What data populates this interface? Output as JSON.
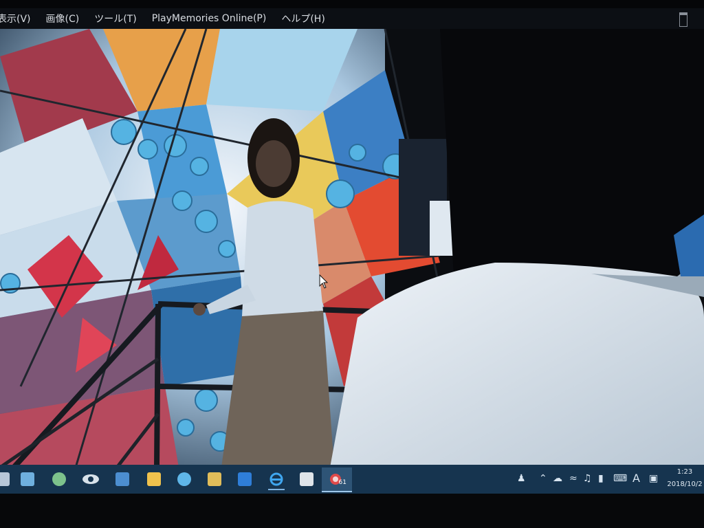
{
  "menubar": {
    "items": [
      "表示(V)",
      "画像(C)",
      "ツール(T)",
      "PlayMemories Online(P)",
      "ヘルプ(H)"
    ]
  },
  "taskbar": {
    "apps": [
      {
        "icon": "file-app-icon",
        "color": "#b8c7d8"
      },
      {
        "icon": "photo-editor-icon",
        "color": "#6fb0de"
      },
      {
        "icon": "green-app-icon",
        "color": "#7dc28c"
      },
      {
        "icon": "eye-icon",
        "color": "#d8e2ea"
      },
      {
        "icon": "blue-app-icon",
        "color": "#4c8ed0"
      },
      {
        "icon": "file-explorer-icon",
        "color": "#f0c24d"
      },
      {
        "icon": "globe-icon",
        "color": "#5fb6e8"
      },
      {
        "icon": "photos-folder-icon",
        "color": "#e1bd5a"
      },
      {
        "icon": "outlook-icon",
        "color": "#2f7ed8"
      },
      {
        "icon": "internet-explorer-icon",
        "color": "#3fa6ef"
      },
      {
        "icon": "calculator-icon",
        "color": "#dfe4e9"
      },
      {
        "icon": "playmemories-icon",
        "color": "#e04a4a",
        "badge": "61"
      }
    ],
    "tray": {
      "ime_label": "A",
      "time": "1:23",
      "date": "2018/10/2"
    }
  },
  "colors": {
    "menubar_bg": "#0c0f14",
    "taskbar_bg": "#16344f",
    "accent_blue": "#5fb6e8",
    "accent_red": "#e04a3a",
    "shirt_white": "#dde6ee"
  }
}
